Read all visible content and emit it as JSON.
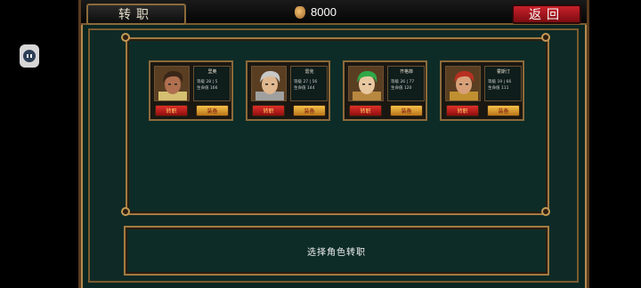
{
  "header": {
    "title": "转职",
    "gold": "8000",
    "back_label": "返回"
  },
  "characters": [
    {
      "name": "里奥",
      "level_label": "等级",
      "level": "28 | 5",
      "hp_label": "生命值",
      "hp": "166",
      "switch_label": "转职",
      "equip_label": "装备",
      "hair": "#3a2618",
      "skin": "#b07050",
      "armor": "#d4c070"
    },
    {
      "name": "雷克",
      "level_label": "等级",
      "level": "27 | 56",
      "hp_label": "生命值",
      "hp": "144",
      "switch_label": "转职",
      "equip_label": "装备",
      "hair": "#c8c8c8",
      "skin": "#e0b890",
      "armor": "#a0a0a0"
    },
    {
      "name": "齐格菲",
      "level_label": "等级",
      "level": "26 | 77",
      "hp_label": "生命值",
      "hp": "120",
      "switch_label": "转职",
      "equip_label": "装备",
      "hair": "#30a848",
      "skin": "#e8c8a0",
      "armor": "#b88840"
    },
    {
      "name": "霍斯汀",
      "level_label": "等级",
      "level": "19 | 66",
      "hp_label": "生命值",
      "hp": "111",
      "switch_label": "转职",
      "equip_label": "装备",
      "hair": "#b83020",
      "skin": "#d8a078",
      "armor": "#c09030"
    }
  ],
  "info": {
    "message": "选择角色转职"
  }
}
